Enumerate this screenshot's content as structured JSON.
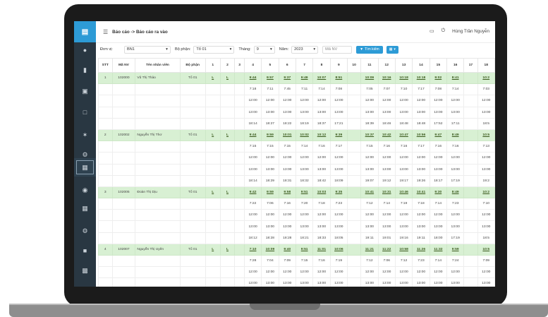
{
  "header": {
    "breadcrumb": "Báo cáo -> Báo cáo ra vào",
    "user_name": "Hùng Trần Nguyễn",
    "calendar_icon": "calendar-icon",
    "power_icon": "power-icon"
  },
  "filters": {
    "unit_label": "Đơn vị:",
    "unit_value": "BN1",
    "dept_label": "Bộ phận:",
    "dept_value": "Tổ 01",
    "month_label": "Tháng:",
    "month_value": "9",
    "year_label": "Năm:",
    "year_value": "2023",
    "staff_placeholder": "Mã NV",
    "search_label": "Tìm kiếm"
  },
  "table": {
    "columns": [
      "STT",
      "Mã NV",
      "Tên nhân viên",
      "Bộ phận",
      "1",
      "2",
      "3",
      "4",
      "5",
      "6",
      "7",
      "8",
      "9",
      "10",
      "11",
      "12",
      "13",
      "14",
      "15",
      "16",
      "17",
      "18"
    ],
    "employees": [
      {
        "stt": "1",
        "id": "102000",
        "name": "Vũ Thị Thảo",
        "dept": "Tổ 01",
        "day1": "L",
        "day2": "L",
        "first_in": [
          "9:44",
          "9:57",
          "9:37",
          "9:49",
          "10:07",
          "8:51",
          "",
          "10:09",
          "10:16",
          "10:18",
          "10:18",
          "9:02",
          "8:41",
          "",
          "10:2"
        ],
        "rows": [
          [
            "7:18",
            "7:11",
            "7:45",
            "7:11",
            "7:14",
            "7:08",
            "",
            "7:05",
            "7:07",
            "7:10",
            "7:17",
            "7:08",
            "7:14",
            "",
            "7:03"
          ],
          [
            "12:00",
            "12:00",
            "12:00",
            "12:00",
            "12:00",
            "12:00",
            "",
            "12:00",
            "12:00",
            "12:00",
            "12:00",
            "12:00",
            "12:00",
            "",
            "12:00"
          ],
          [
            "13:00",
            "13:00",
            "13:00",
            "13:00",
            "13:00",
            "13:00",
            "",
            "13:00",
            "13:00",
            "13:00",
            "13:00",
            "13:00",
            "13:00",
            "",
            "13:00"
          ],
          [
            "18:14",
            "18:27",
            "18:22",
            "18:19",
            "18:37",
            "17:21",
            "",
            "18:39",
            "18:46",
            "18:48",
            "18:48",
            "17:52",
            "17:11",
            "",
            "18:5"
          ]
        ]
      },
      {
        "stt": "2",
        "id": "102002",
        "name": "Nguyễn Thị Thơ",
        "dept": "Tổ 01",
        "day1": "L",
        "day2": "L",
        "first_in": [
          "9:44",
          "9:59",
          "10:01",
          "10:02",
          "10:12",
          "9:39",
          "",
          "10:37",
          "10:42",
          "10:47",
          "10:56",
          "9:47",
          "8:49",
          "",
          "10:5"
        ],
        "rows": [
          [
            "7:15",
            "7:15",
            "7:15",
            "7:14",
            "7:16",
            "7:17",
            "",
            "7:15",
            "7:16",
            "7:16",
            "7:17",
            "7:16",
            "7:16",
            "",
            "7:13"
          ],
          [
            "12:00",
            "12:00",
            "12:00",
            "12:00",
            "12:00",
            "12:00",
            "",
            "12:00",
            "12:00",
            "12:00",
            "12:00",
            "12:00",
            "12:00",
            "",
            "12:00"
          ],
          [
            "13:00",
            "13:00",
            "13:00",
            "13:00",
            "13:00",
            "13:00",
            "",
            "13:00",
            "13:00",
            "13:00",
            "13:00",
            "13:00",
            "13:00",
            "",
            "13:00"
          ],
          [
            "18:14",
            "18:29",
            "18:31",
            "18:32",
            "18:42",
            "18:09",
            "",
            "19:07",
            "19:12",
            "19:17",
            "19:26",
            "18:17",
            "17:19",
            "",
            "19:2"
          ]
        ]
      },
      {
        "stt": "3",
        "id": "102005",
        "name": "Đoàn Thị Dịu",
        "dept": "Tổ 01",
        "day1": "L",
        "day2": "L",
        "first_in": [
          "9:42",
          "9:59",
          "9:58",
          "9:51",
          "10:03",
          "9:35",
          "",
          "10:41",
          "10:31",
          "10:46",
          "10:41",
          "9:30",
          "8:49",
          "",
          "10:2"
        ],
        "rows": [
          [
            "7:22",
            "7:06",
            "7:16",
            "7:20",
            "7:18",
            "7:23",
            "",
            "7:12",
            "7:14",
            "7:19",
            "7:18",
            "7:14",
            "7:23",
            "",
            "7:10"
          ],
          [
            "12:00",
            "12:00",
            "12:00",
            "12:00",
            "12:00",
            "12:00",
            "",
            "12:00",
            "12:00",
            "12:00",
            "12:00",
            "12:00",
            "12:00",
            "",
            "12:00"
          ],
          [
            "13:00",
            "13:00",
            "13:00",
            "13:00",
            "13:00",
            "13:00",
            "",
            "13:00",
            "13:00",
            "13:00",
            "13:00",
            "13:00",
            "13:00",
            "",
            "13:00"
          ],
          [
            "18:12",
            "18:28",
            "18:28",
            "18:21",
            "18:33",
            "18:05",
            "",
            "19:11",
            "19:01",
            "19:16",
            "19:11",
            "18:00",
            "17:19",
            "",
            "18:5"
          ]
        ]
      },
      {
        "stt": "4",
        "id": "102007",
        "name": "Nguyễn Thị Uyên",
        "dept": "Tổ 01",
        "day1": "L",
        "day2": "L",
        "first_in": [
          "7:10",
          "10:09",
          "9:40",
          "9:51",
          "11:01",
          "10:06",
          "",
          "11:21",
          "11:22",
          "10:58",
          "11:26",
          "11:32",
          "9:59",
          "",
          "10:5"
        ],
        "rows": [
          [
            "7:28",
            "7:04",
            "7:09",
            "7:15",
            "7:16",
            "7:19",
            "",
            "7:12",
            "7:06",
            "7:12",
            "7:23",
            "7:14",
            "7:24",
            "",
            "7:09"
          ],
          [
            "12:00",
            "12:00",
            "12:00",
            "12:00",
            "12:00",
            "12:00",
            "",
            "12:00",
            "12:00",
            "12:00",
            "12:00",
            "12:00",
            "12:00",
            "",
            "12:00"
          ],
          [
            "13:00",
            "13:00",
            "13:00",
            "13:00",
            "13:00",
            "13:00",
            "",
            "13:00",
            "13:00",
            "13:00",
            "13:00",
            "13:00",
            "13:00",
            "",
            "13:00"
          ],
          [
            "15:40",
            "18:39",
            "18:10",
            "18:21",
            "19:31",
            "18:36",
            "",
            "19:51",
            "19:52",
            "19:28",
            "19:56",
            "20:02",
            "17:29",
            "",
            "18:2"
          ]
        ]
      }
    ]
  },
  "sidebar": {
    "icons": [
      "chart-icon",
      "user-icon",
      "bar-chart-icon",
      "document-icon",
      "file-icon",
      "settings-icon",
      "tools-icon",
      "table-icon",
      "globe-icon",
      "grid-icon",
      "gears-icon",
      "book-icon",
      "screen-icon"
    ]
  },
  "colors": {
    "accent": "#2d9bd6",
    "sidebar": "#293742",
    "employee_row": "#d8f0d3"
  }
}
